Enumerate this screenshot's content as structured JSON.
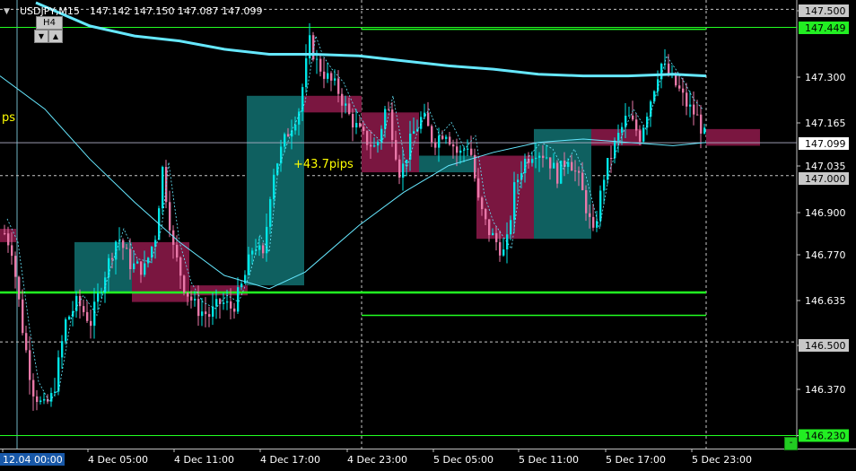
{
  "window": {
    "symbol": "USDJPY,M15",
    "ohlc": "147.142 147.150 147.087 147.099",
    "header_arrow": "▼"
  },
  "controls": {
    "timeframe_label": "H4",
    "scroll_down_icon": "▼",
    "scroll_up_icon": "▲",
    "minus_button": "-"
  },
  "annotations": {
    "left_fragment": "ps",
    "pips": "+43.7pips"
  },
  "colors": {
    "background": "#000000",
    "bull_candle": "#00e5e5",
    "bear_candle": "#e878a8",
    "bull_box": "#0f6060",
    "bear_box": "#7a1640",
    "ma_line": "#66e8ff",
    "level_line": "#22ff22",
    "text_yellow": "#ffff00",
    "grid": "#c0c0c0"
  },
  "price_axis": {
    "ticks": [
      "147.500",
      "147.300",
      "147.165",
      "147.035",
      "146.900",
      "146.770",
      "146.635",
      "146.500",
      "146.370",
      "146.230"
    ],
    "tags": [
      {
        "label": "147.500",
        "kind": "gray"
      },
      {
        "label": "147.449",
        "kind": "green"
      },
      {
        "label": "147.099",
        "kind": "white"
      },
      {
        "label": "147.000",
        "kind": "gray"
      },
      {
        "label": "146.500",
        "kind": "gray"
      },
      {
        "label": "146.230",
        "kind": "green"
      }
    ]
  },
  "time_axis": {
    "labels": [
      "12.04 00:00",
      "4 Dec 05:00",
      "4 Dec 11:00",
      "4 Dec 17:00",
      "4 Dec 23:00",
      "5 Dec 05:00",
      "5 Dec 11:00",
      "5 Dec 17:00",
      "5 Dec 23:00"
    ]
  },
  "chart_data": {
    "type": "candlestick",
    "symbol": "USDJPY",
    "timeframe": "M15",
    "y_range": [
      146.2,
      147.55
    ],
    "x_labels": [
      "12.04 00:00",
      "4 Dec 05:00",
      "4 Dec 11:00",
      "4 Dec 17:00",
      "4 Dec 23:00",
      "5 Dec 05:00",
      "5 Dec 11:00",
      "5 Dec 17:00",
      "5 Dec 23:00"
    ],
    "current_price": 147.099,
    "horizontal_levels": [
      147.449,
      146.65
    ],
    "range_lines": [
      147.44,
      146.58
    ],
    "dashed_levels": [
      147.5,
      147.0,
      146.5
    ],
    "h4_boxes": [
      {
        "dir": "bull",
        "open": 146.65,
        "close": 146.8
      },
      {
        "dir": "bear",
        "open": 146.8,
        "close": 146.62
      },
      {
        "dir": "bear",
        "open": 146.64,
        "close": 146.67
      },
      {
        "dir": "bull",
        "open": 146.67,
        "close": 147.24
      },
      {
        "dir": "bear",
        "open": 147.24,
        "close": 147.19
      },
      {
        "dir": "bear",
        "open": 147.19,
        "close": 147.01
      },
      {
        "dir": "bull",
        "open": 147.01,
        "close": 147.06
      },
      {
        "dir": "bear",
        "open": 147.06,
        "close": 146.81
      },
      {
        "dir": "bull",
        "open": 146.81,
        "close": 147.14
      },
      {
        "dir": "bear",
        "open": 147.14,
        "close": 147.09
      }
    ],
    "close_path": [
      [
        0,
        146.85
      ],
      [
        12,
        146.78
      ],
      [
        25,
        146.52
      ],
      [
        35,
        146.36
      ],
      [
        47,
        146.3
      ],
      [
        58,
        146.34
      ],
      [
        72,
        146.56
      ],
      [
        85,
        146.62
      ],
      [
        100,
        146.56
      ],
      [
        115,
        146.7
      ],
      [
        130,
        146.82
      ],
      [
        145,
        146.73
      ],
      [
        160,
        146.72
      ],
      [
        172,
        146.82
      ],
      [
        180,
        147.02
      ],
      [
        192,
        146.78
      ],
      [
        205,
        146.66
      ],
      [
        218,
        146.6
      ],
      [
        232,
        146.58
      ],
      [
        245,
        146.62
      ],
      [
        258,
        146.6
      ],
      [
        270,
        146.68
      ],
      [
        282,
        146.8
      ],
      [
        292,
        146.75
      ],
      [
        302,
        147.0
      ],
      [
        318,
        147.12
      ],
      [
        332,
        147.2
      ],
      [
        344,
        147.4
      ],
      [
        352,
        147.34
      ],
      [
        362,
        147.3
      ],
      [
        375,
        147.26
      ],
      [
        388,
        147.18
      ],
      [
        402,
        147.12
      ],
      [
        418,
        147.08
      ],
      [
        430,
        147.22
      ],
      [
        445,
        147.0
      ],
      [
        458,
        147.12
      ],
      [
        470,
        147.18
      ],
      [
        482,
        147.1
      ],
      [
        495,
        147.14
      ],
      [
        510,
        147.06
      ],
      [
        522,
        147.1
      ],
      [
        532,
        146.92
      ],
      [
        542,
        146.84
      ],
      [
        552,
        146.8
      ],
      [
        562,
        146.76
      ],
      [
        572,
        146.96
      ],
      [
        582,
        147.04
      ],
      [
        595,
        147.08
      ],
      [
        608,
        147.06
      ],
      [
        620,
        147.0
      ],
      [
        632,
        147.06
      ],
      [
        645,
        146.98
      ],
      [
        660,
        146.82
      ],
      [
        672,
        147.0
      ],
      [
        685,
        147.1
      ],
      [
        698,
        147.18
      ],
      [
        712,
        147.12
      ],
      [
        725,
        147.24
      ],
      [
        735,
        147.34
      ],
      [
        745,
        147.3
      ],
      [
        755,
        147.26
      ],
      [
        765,
        147.21
      ],
      [
        775,
        147.18
      ],
      [
        787,
        147.1
      ]
    ],
    "ma_200": [
      [
        40,
        147.52
      ],
      [
        100,
        147.45
      ],
      [
        150,
        147.42
      ],
      [
        200,
        147.405
      ],
      [
        250,
        147.38
      ],
      [
        300,
        147.365
      ],
      [
        350,
        147.365
      ],
      [
        400,
        147.36
      ],
      [
        450,
        147.345
      ],
      [
        500,
        147.33
      ],
      [
        550,
        147.32
      ],
      [
        600,
        147.305
      ],
      [
        650,
        147.3
      ],
      [
        700,
        147.3
      ],
      [
        750,
        147.305
      ],
      [
        787,
        147.3
      ]
    ],
    "ma_slow": [
      [
        0,
        147.3
      ],
      [
        50,
        147.2
      ],
      [
        100,
        147.05
      ],
      [
        150,
        146.92
      ],
      [
        200,
        146.8
      ],
      [
        250,
        146.7
      ],
      [
        300,
        146.66
      ],
      [
        340,
        146.71
      ],
      [
        400,
        146.85
      ],
      [
        450,
        146.95
      ],
      [
        500,
        147.03
      ],
      [
        550,
        147.07
      ],
      [
        600,
        147.1
      ],
      [
        650,
        147.11
      ],
      [
        700,
        147.1
      ],
      [
        750,
        147.09
      ],
      [
        787,
        147.1
      ]
    ]
  }
}
